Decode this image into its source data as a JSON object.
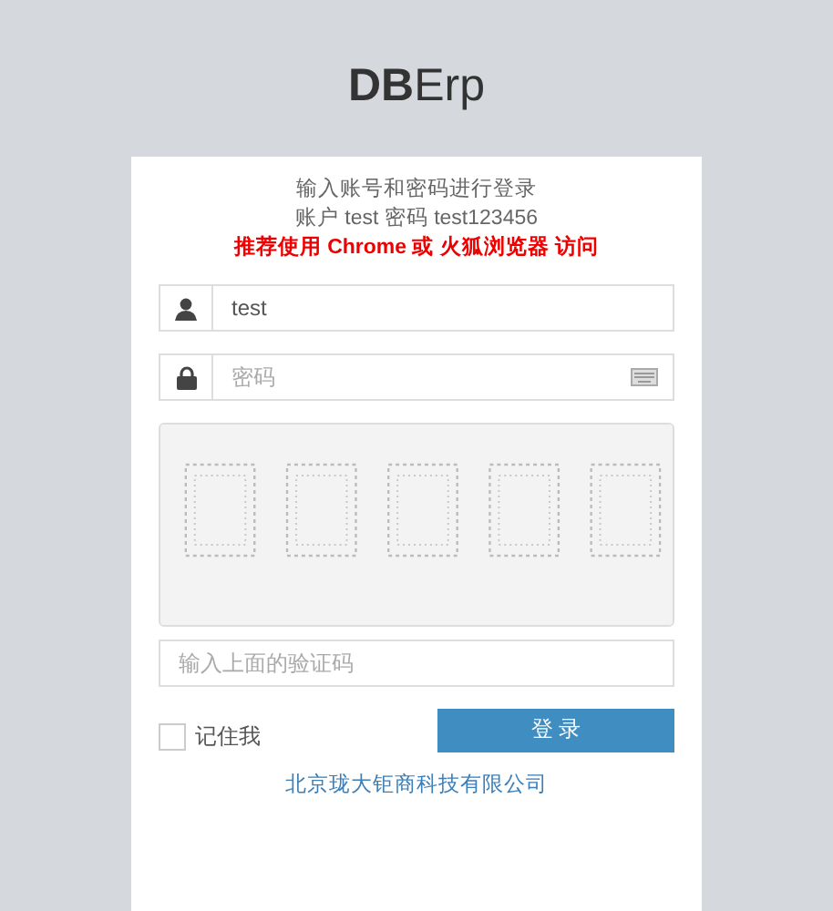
{
  "logo": "**DB**Erp",
  "intro": [
    "输入账号和密码进行登录",
    "账户 test 密码 test123456"
  ],
  "notice": "推荐使用 Chrome 或 火狐浏览器 访问",
  "username": {
    "value": "test"
  },
  "password": {
    "placeholder": "密码"
  },
  "captcha_field": {
    "placeholder": "输入上面的验证码"
  },
  "remember": {
    "label": "记住我",
    "checked": false
  },
  "login_button": "登 录",
  "footer_link": "北京珑大钜商科技有限公司"
}
